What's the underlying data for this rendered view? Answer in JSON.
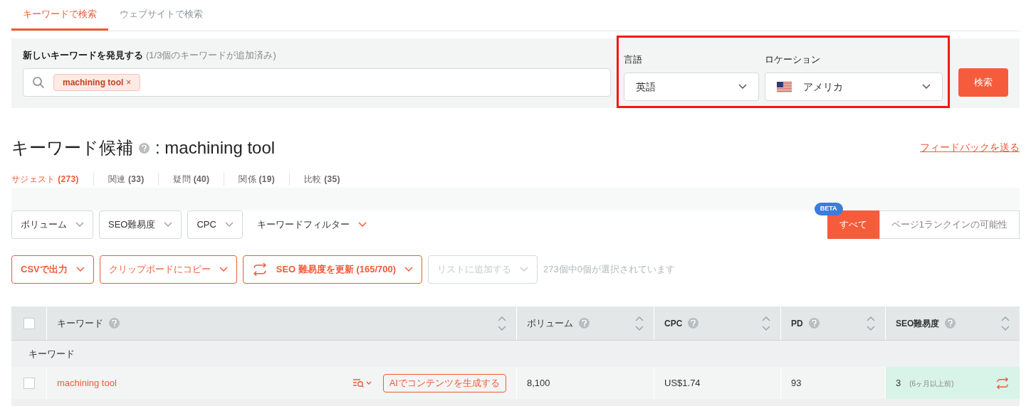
{
  "tabs": [
    {
      "label": "キーワードで検索",
      "selected": true
    },
    {
      "label": "ウェブサイトで検索",
      "selected": false
    }
  ],
  "search_panel": {
    "heading": "新しいキーワードを発見する",
    "heading_note": "(1/3個のキーワードが追加済み)",
    "chips": [
      {
        "label": "machining tool",
        "remove": "×"
      }
    ],
    "language": {
      "label": "言語",
      "value": "英語"
    },
    "location": {
      "label": "ロケーション",
      "value": "アメリカ"
    },
    "highlighted": true,
    "search_button": "検索"
  },
  "title": "キーワード候補",
  "title_suffix": ": machining tool",
  "feedback_link": "フィードバックを送る",
  "sub_tabs": [
    {
      "label": "サジェスト",
      "count": "(273)",
      "selected": true
    },
    {
      "label": "関連",
      "count": "(33)",
      "selected": false
    },
    {
      "label": "疑問",
      "count": "(40)",
      "selected": false
    },
    {
      "label": "関係",
      "count": "(19)",
      "selected": false
    },
    {
      "label": "比較",
      "count": "(35)",
      "selected": false
    }
  ],
  "filters": [
    "ボリューム",
    "SEO難易度",
    "CPC"
  ],
  "keyword_filter": "キーワードフィルター",
  "toggle": {
    "badge": "BETA",
    "options": [
      {
        "label": "すべて",
        "selected": true
      },
      {
        "label": "ページ1ランクインの可能性",
        "selected": false
      }
    ]
  },
  "actions": [
    {
      "label": "CSVで出力",
      "kind": "plain",
      "disabled": false
    },
    {
      "label": "クリップボードにコピー",
      "kind": "plain",
      "disabled": false
    },
    {
      "label": "SEO 難易度を更新 (165/700)",
      "kind": "refresh",
      "disabled": false
    },
    {
      "label": "リストに追加する",
      "kind": "plain",
      "disabled": true
    }
  ],
  "selection_note": "273個中0個が選択されています",
  "table": {
    "select_all": false,
    "columns": [
      "キーワード",
      "ボリューム",
      "CPC",
      "PD",
      "SEO難易度"
    ],
    "group": "キーワード",
    "rows": [
      {
        "checked": false,
        "keyword": "machining tool",
        "ai_button": "AIでコンテンツを生成する",
        "volume": "8,100",
        "cpc": "US$1.74",
        "pd": "93",
        "seo": "3",
        "seo_note": "(6ヶ月以上前)"
      }
    ]
  }
}
